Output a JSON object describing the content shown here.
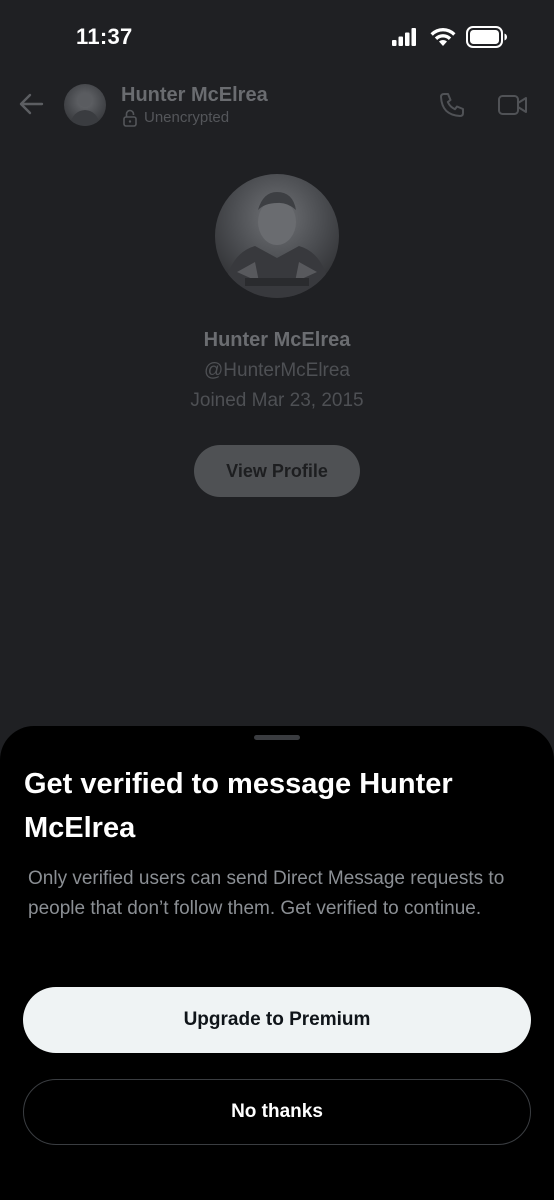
{
  "status_bar": {
    "time": "11:37",
    "icons": [
      "cellular-signal-icon",
      "wifi-icon",
      "battery-icon"
    ]
  },
  "header": {
    "back_icon": "arrow-left-icon",
    "name": "Hunter McElrea",
    "status": "Unencrypted",
    "status_icon": "lock-icon",
    "actions": [
      "phone-icon",
      "video-camera-icon"
    ]
  },
  "profile": {
    "name": "Hunter McElrea",
    "handle": "@HunterMcElrea",
    "joined": "Joined Mar 23, 2015",
    "view_profile_label": "View Profile"
  },
  "sheet": {
    "title": "Get verified to message Hunter McElrea",
    "body": "Only verified users can send Direct Message requests to people that don’t follow them.  Get verified to continue.",
    "primary_label": "Upgrade to Premium",
    "secondary_label": "No thanks"
  },
  "colors": {
    "background_dimmed": "#1f2023",
    "sheet_background": "#000000",
    "primary_button": "#eff3f4",
    "text_primary": "#ffffff",
    "text_secondary": "#8b8f94"
  }
}
